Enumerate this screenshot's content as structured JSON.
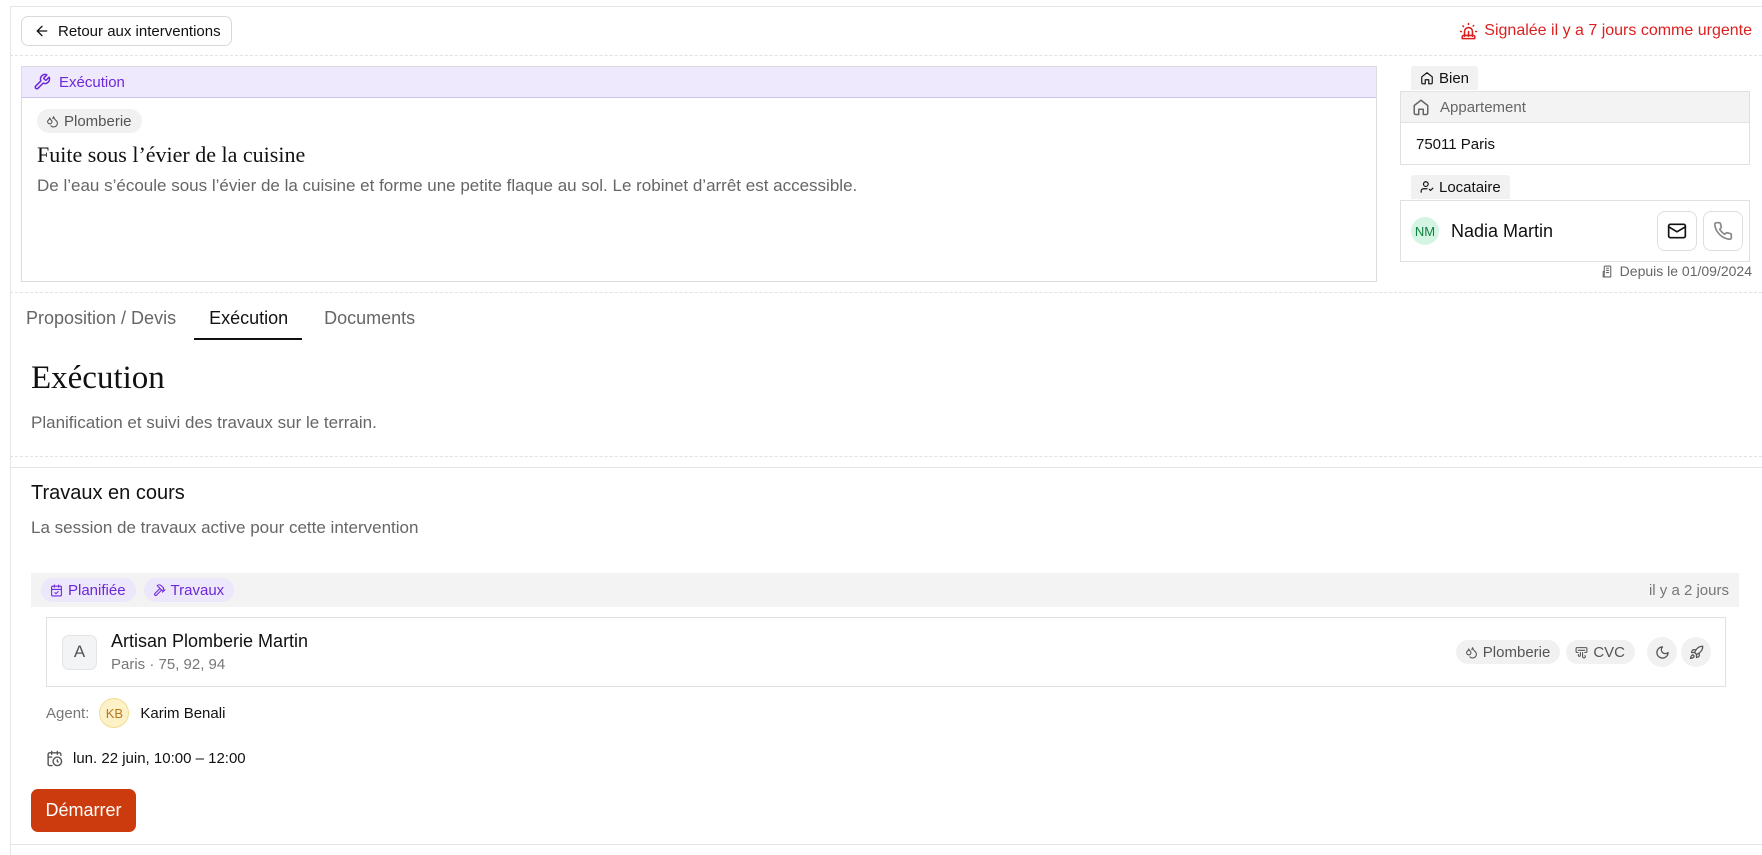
{
  "header": {
    "back_label": "Retour aux interventions",
    "urgent_label": "Signalée il y a 7 jours comme urgente",
    "urgent_color": "#dc1f1f"
  },
  "execution_card": {
    "status": "Exécution",
    "category": "Plomberie",
    "title": "Fuite sous l’évier de la cuisine",
    "description": "De l’eau s’écoule sous l’évier de la cuisine et forme une petite flaque au sol. Le robinet d’arrêt est accessible.",
    "accent_color": "#6d28d9"
  },
  "property": {
    "label": "Bien",
    "type": "Appartement",
    "address": "75011 Paris"
  },
  "tenant": {
    "label": "Locataire",
    "initials": "NM",
    "name": "Nadia Martin",
    "since": "Depuis le 01/09/2024"
  },
  "tabs": [
    {
      "label": "Proposition / Devis",
      "active": false
    },
    {
      "label": "Exécution",
      "active": true
    },
    {
      "label": "Documents",
      "active": false
    }
  ],
  "section": {
    "title": "Exécution",
    "subtitle": "Planification et suivi des travaux sur le terrain."
  },
  "work": {
    "title": "Travaux en cours",
    "subtitle": "La session de travaux active pour cette intervention",
    "status_chip": "Planifiée",
    "type_chip": "Travaux",
    "time_ago": "il y a 2 jours",
    "artisan": {
      "initial": "A",
      "name": "Artisan Plomberie Martin",
      "location": "Paris · 75, 92, 94",
      "tags": [
        "Plomberie",
        "CVC"
      ]
    },
    "agent": {
      "label": "Agent:",
      "initials": "KB",
      "name": "Karim Benali"
    },
    "schedule": "lun. 22 juin, 10:00 – 12:00",
    "start_button": "Démarrer",
    "start_color": "#cc3b0d"
  }
}
